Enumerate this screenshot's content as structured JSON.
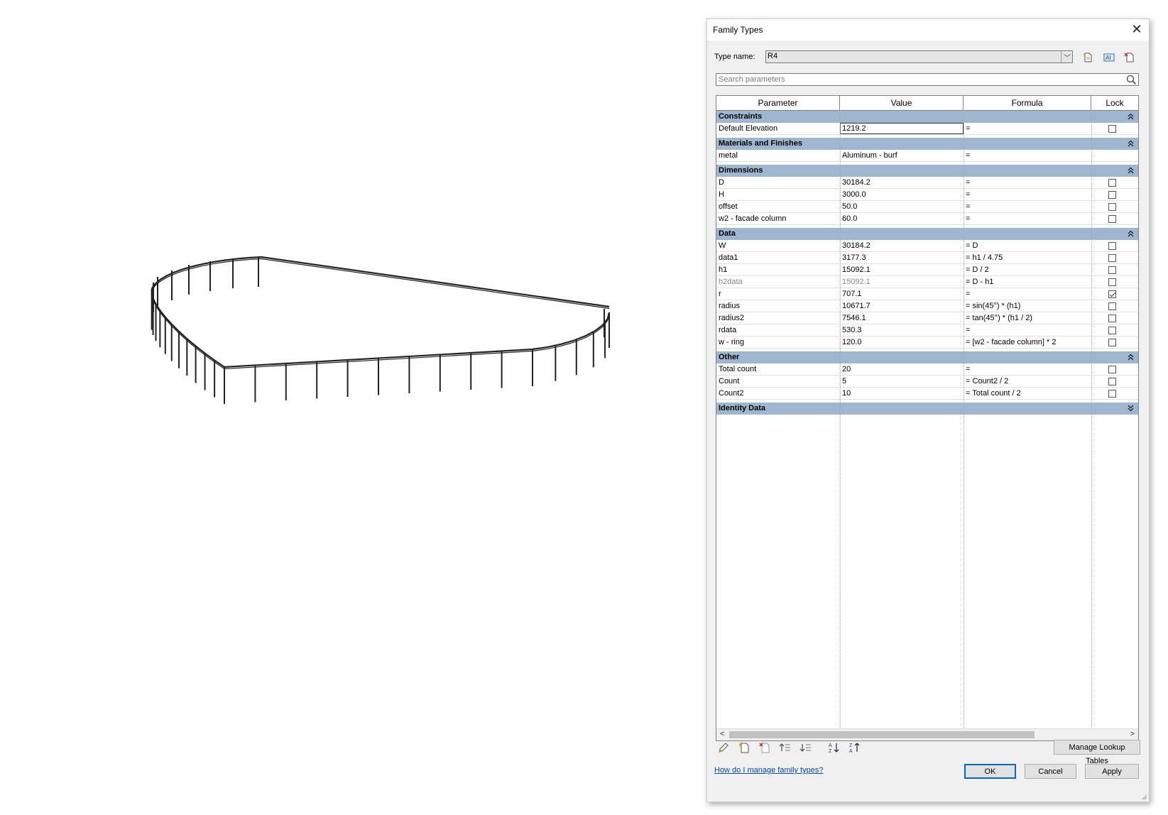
{
  "dialog": {
    "title": "Family Types",
    "type_name_label": "Type name:",
    "type_name_value": "R4",
    "search_placeholder": "Search parameters",
    "columns": [
      "Parameter",
      "Value",
      "Formula",
      "Lock"
    ],
    "sections": [
      {
        "name": "Constraints",
        "expanded": true,
        "rows": [
          {
            "param": "Default Elevation",
            "value": "1219.2",
            "formula": "=",
            "lock": false,
            "has_lock": true,
            "editing": true
          }
        ]
      },
      {
        "name": "Materials and Finishes",
        "expanded": true,
        "rows": [
          {
            "param": "metal",
            "value": "Aluminum - burf",
            "formula": "=",
            "has_lock": false
          }
        ]
      },
      {
        "name": "Dimensions",
        "expanded": true,
        "rows": [
          {
            "param": "D",
            "value": "30184.2",
            "formula": "=",
            "lock": false,
            "has_lock": true
          },
          {
            "param": "H",
            "value": "3000.0",
            "formula": "=",
            "lock": false,
            "has_lock": true
          },
          {
            "param": "offset",
            "value": "50.0",
            "formula": "=",
            "lock": false,
            "has_lock": true
          },
          {
            "param": "w2 -  facade column",
            "value": "60.0",
            "formula": "=",
            "lock": false,
            "has_lock": true
          }
        ]
      },
      {
        "name": "Data",
        "expanded": true,
        "rows": [
          {
            "param": "W",
            "value": "30184.2",
            "formula": "= D",
            "lock": false,
            "has_lock": true
          },
          {
            "param": "data1",
            "value": "3177.3",
            "formula": "= h1 / 4.75",
            "lock": false,
            "has_lock": true
          },
          {
            "param": "h1",
            "value": "15092.1",
            "formula": "= D / 2",
            "lock": false,
            "has_lock": true
          },
          {
            "param": "h2data",
            "value": "15092.1",
            "formula": "= D - h1",
            "lock": false,
            "has_lock": true,
            "grey": true
          },
          {
            "param": "r",
            "value": "707.1",
            "formula": "=",
            "lock": true,
            "has_lock": true
          },
          {
            "param": "radius",
            "value": "10671.7",
            "formula": "= sin(45°) * (h1)",
            "lock": false,
            "has_lock": true
          },
          {
            "param": "radius2",
            "value": "7546.1",
            "formula": "= tan(45°) * (h1 / 2)",
            "lock": false,
            "has_lock": true
          },
          {
            "param": "rdata",
            "value": "530.3",
            "formula": "=",
            "lock": false,
            "has_lock": true
          },
          {
            "param": "w - ring",
            "value": "120.0",
            "formula": "= [w2 -  facade column] * 2",
            "lock": false,
            "has_lock": true
          }
        ]
      },
      {
        "name": "Other",
        "expanded": true,
        "rows": [
          {
            "param": "Total count",
            "value": "20",
            "formula": "=",
            "lock": false,
            "has_lock": true
          },
          {
            "param": "Count",
            "value": "5",
            "formula": "= Count2 / 2",
            "lock": false,
            "has_lock": true
          },
          {
            "param": "Count2",
            "value": "10",
            "formula": "= Total count / 2",
            "lock": false,
            "has_lock": true
          }
        ]
      },
      {
        "name": "Identity Data",
        "expanded": false,
        "rows": []
      }
    ],
    "help_link": "How do I manage family types?",
    "manage_lookup_label": "Manage Lookup Tables",
    "ok_label": "OK",
    "cancel_label": "Cancel",
    "apply_label": "Apply",
    "toolbar_icons": [
      "pencil-icon",
      "new-parameter-icon",
      "delete-parameter-icon",
      "move-up-icon",
      "move-down-icon",
      "sort-ascending-icon",
      "sort-descending-icon"
    ],
    "colors": {
      "section_header": "#9fb6d1",
      "link": "#0645ad",
      "primary_border": "#0a64c8"
    }
  }
}
